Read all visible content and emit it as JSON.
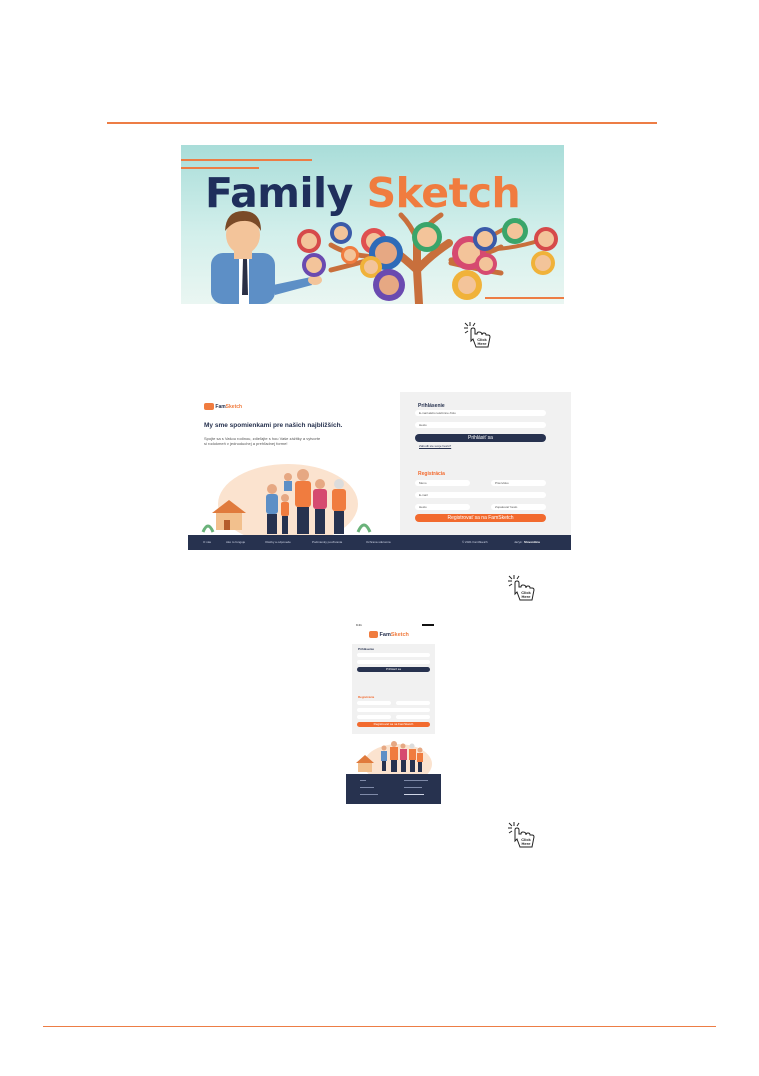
{
  "banner": {
    "word1": "Family",
    "word2": "Sketch"
  },
  "click_here": "Click Here",
  "desktop": {
    "logo_a": "Fam",
    "logo_b": "Sketch",
    "headline": "My sme spomienkami pre našich najbližších.",
    "subtext_1": "Spojte sa s Vašou rodinou, zdieľajte s hou Vaše zážitky a vytvorte",
    "subtext_2": "si rodokmeň v jednoduchej a prehľadnej forme!",
    "login_title": "Prihlásenie",
    "login_email_ph": "E-mail alebo telefónne číslo",
    "login_pass_ph": "Heslo",
    "login_button": "Prihlásiť sa",
    "forgot": "Zabudli ste svoje heslo?",
    "reg_title": "Registrácia",
    "reg_name_ph": "Meno",
    "reg_surname_ph": "Priezvisko",
    "reg_email_ph": "E-mail",
    "reg_pass_ph": "Heslo",
    "reg_pass2_ph": "Zopakovať heslo",
    "reg_button": "Registrovať sa na FamSketch",
    "footer_links": [
      "O nás",
      "Ako to funguje",
      "Otázky a odpovede",
      "Podmienky používania",
      "Ochrana súkromia"
    ],
    "footer_copy": "© 2021 FamSketch",
    "footer_lang_label": "Jazyk:",
    "footer_lang": "Slovenčina"
  },
  "mobile": {
    "status_time": "9:41",
    "logo_a": "Fam",
    "logo_b": "Sketch",
    "login_title": "Prihlásenie",
    "login_button": "Prihlásiť sa",
    "reg_title": "Registrácia",
    "reg_button": "Registrovať sa na FamSketch"
  }
}
